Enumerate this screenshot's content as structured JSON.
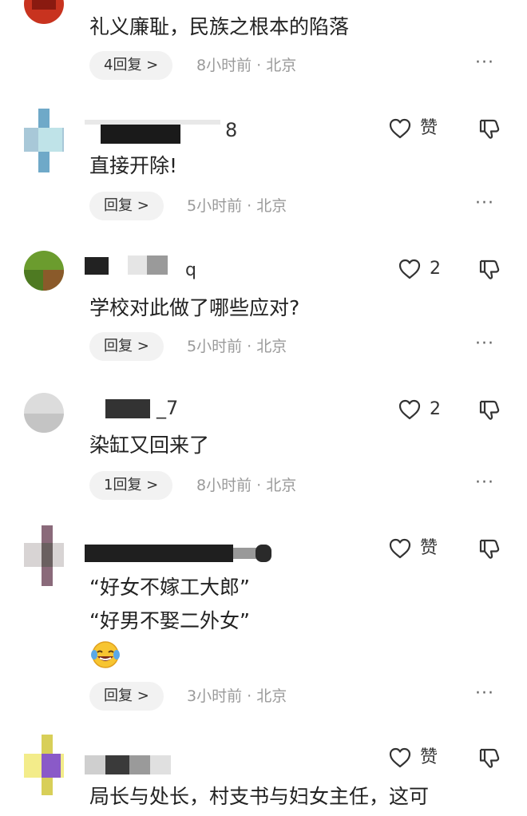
{
  "comments": [
    {
      "text": "礼义廉耻，民族之根本的陷落",
      "reply_label": "4回复 >",
      "meta": "8小时前 · 北京",
      "more": "···"
    },
    {
      "username_fragment": "8",
      "text": "直接开除!",
      "like_label": "赞",
      "reply_label": "回复 >",
      "meta": "5小时前 · 北京",
      "more": "···"
    },
    {
      "username_fragment": "q",
      "text": "学校对此做了哪些应对?",
      "like_label": "2",
      "reply_label": "回复 >",
      "meta": "5小时前 · 北京",
      "more": "···"
    },
    {
      "username_fragment": "_7",
      "text": "染缸又回来了",
      "like_label": "2",
      "reply_label": "1回复 >",
      "meta": "8小时前 · 北京",
      "more": "···"
    },
    {
      "lines": [
        "“好女不嫁工大郎”",
        "“好男不娶二外女”"
      ],
      "like_label": "赞",
      "reply_label": "回复 >",
      "meta": "3小时前 · 北京",
      "more": "···",
      "emoji": "laughing-crying-emoji"
    },
    {
      "text": "局长与处长，村支书与妇女主任，这可",
      "like_label": "赞"
    }
  ],
  "icons": {
    "like": "heart-outline-icon",
    "dislike": "thumbs-down-icon",
    "more": "more-dots-icon"
  },
  "colors": {
    "text": "#222222",
    "meta": "#9a9a9a",
    "reply_bg": "#f2f2f2"
  }
}
